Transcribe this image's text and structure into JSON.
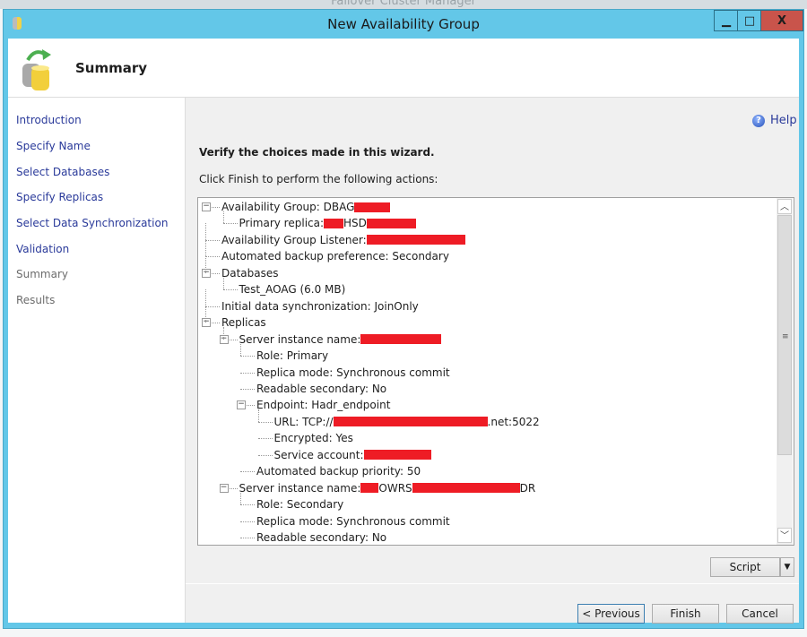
{
  "background_window_title": "Failover Cluster Manager",
  "window": {
    "title": "New Availability Group",
    "minimize": "▁",
    "maximize": "□",
    "close": "X",
    "close_color": "#c9544b",
    "titlebar_color": "#63c7e8"
  },
  "header": {
    "title": "Summary",
    "icon": "database-refresh-icon"
  },
  "nav": [
    {
      "label": "Introduction",
      "enabled": true
    },
    {
      "label": "Specify Name",
      "enabled": true
    },
    {
      "label": "Select Databases",
      "enabled": true
    },
    {
      "label": "Specify Replicas",
      "enabled": true
    },
    {
      "label": "Select Data Synchronization",
      "enabled": true
    },
    {
      "label": "Validation",
      "enabled": true
    },
    {
      "label": "Summary",
      "enabled": false
    },
    {
      "label": "Results",
      "enabled": false
    }
  ],
  "help": {
    "label": "Help",
    "icon": "help-icon"
  },
  "main": {
    "verify_text": "Verify the choices made in this wizard.",
    "instruction": "Click Finish to perform the following actions:"
  },
  "tree": [
    {
      "level": 0,
      "expander": "minus",
      "segments": [
        "Availability Group: DBAG",
        ""
      ]
    },
    {
      "level": 1,
      "segments": [
        "Primary replica: ",
        "",
        "HSD",
        ""
      ]
    },
    {
      "level": 0,
      "segments": [
        "Availability Group Listener: ",
        ""
      ]
    },
    {
      "level": 0,
      "segments": [
        "Automated backup preference: Secondary"
      ]
    },
    {
      "level": 0,
      "expander": "minus",
      "segments": [
        "Databases"
      ]
    },
    {
      "level": 1,
      "segments": [
        "Test_AOAG (6.0 MB)"
      ]
    },
    {
      "level": 0,
      "segments": [
        "Initial data synchronization: JoinOnly"
      ]
    },
    {
      "level": 0,
      "expander": "minus",
      "segments": [
        "Replicas"
      ]
    },
    {
      "level": 1,
      "expander": "minus",
      "segments": [
        "Server instance name: ",
        ""
      ]
    },
    {
      "level": 2,
      "segments": [
        "Role: Primary"
      ]
    },
    {
      "level": 2,
      "segments": [
        "Replica mode: Synchronous commit"
      ]
    },
    {
      "level": 2,
      "segments": [
        "Readable secondary: No"
      ]
    },
    {
      "level": 2,
      "expander": "minus",
      "segments": [
        "Endpoint: Hadr_endpoint"
      ]
    },
    {
      "level": 3,
      "segments": [
        "URL: TCP://",
        "",
        ".net:5022"
      ]
    },
    {
      "level": 3,
      "segments": [
        "Encrypted: Yes"
      ]
    },
    {
      "level": 3,
      "segments": [
        "Service account: ",
        ""
      ]
    },
    {
      "level": 2,
      "segments": [
        "Automated backup priority: 50"
      ]
    },
    {
      "level": 1,
      "expander": "minus",
      "segments": [
        "Server instance name: ",
        "",
        "OWRS",
        "",
        "DR"
      ]
    },
    {
      "level": 2,
      "segments": [
        "Role: Secondary"
      ]
    },
    {
      "level": 2,
      "segments": [
        "Replica mode: Synchronous commit"
      ]
    },
    {
      "level": 2,
      "segments": [
        "Readable secondary: No"
      ]
    }
  ],
  "redaction_color": "#ee1c25",
  "buttons": {
    "script": "Script",
    "script_dropdown": "▼",
    "previous": "< Previous",
    "finish": "Finish",
    "cancel": "Cancel"
  }
}
